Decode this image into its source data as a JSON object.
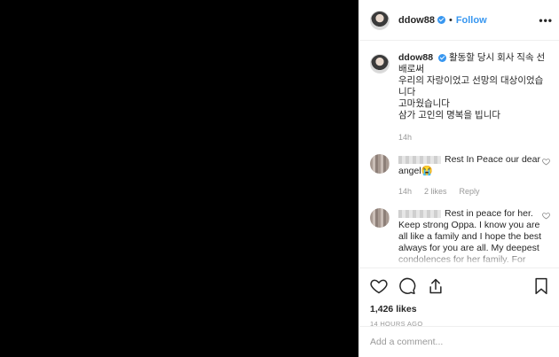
{
  "header": {
    "username": "ddow88",
    "separator": "•",
    "follow_label": "Follow",
    "more_label": "•••"
  },
  "caption": {
    "username": "ddow88",
    "lines": [
      "활동할 당시 회사 직속 선",
      "배로써",
      "우리의 자랑이었고 선망의 대상이었습",
      "니다",
      "고마웠습니다",
      "삼가 고인의 명복을 빕니다"
    ],
    "time": "14h"
  },
  "comments": [
    {
      "text": "Rest In Peace our dear angel😭",
      "time": "14h",
      "likes": "2 likes",
      "reply_label": "Reply"
    },
    {
      "text": "Rest in peace for her. Keep strong Oppa. I know you are all like a family and I hope the best always for you are all. My deepest condolences for her family. For you, be strong and I"
    }
  ],
  "actions": {
    "likes_count": "1,426 likes",
    "time_ago": "14 HOURS AGO"
  },
  "add_comment": {
    "placeholder": "Add a comment..."
  },
  "icons": {
    "verified": "verified-badge-icon",
    "like": "heart-icon",
    "comment": "speech-bubble-icon",
    "share": "share-arrow-icon",
    "save": "bookmark-icon"
  },
  "colors": {
    "accent": "#3897f0",
    "media": "#000000",
    "muted": "#999999"
  }
}
